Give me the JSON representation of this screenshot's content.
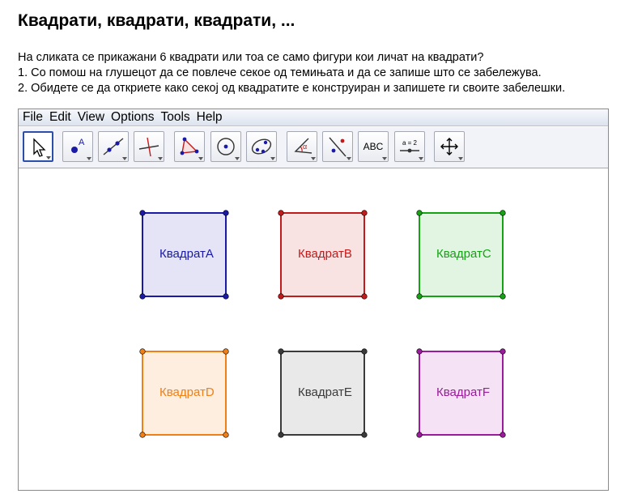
{
  "page": {
    "title": "Квадрати, квадрати, квадрати, ...",
    "instructions": [
      "На сликата се прикажани 6 квадрати или тоа се само фигури кои личат на квадрати?",
      "1. Со помош на глушецот да се повлече секое од темињата и да се запише што се забележува.",
      "2. Обидете се да откриете како секој од квадратите е конструиран и запишете ги своите забелешки."
    ]
  },
  "menu": {
    "items": [
      "File",
      "Edit",
      "View",
      "Options",
      "Tools",
      "Help"
    ]
  },
  "toolbar": {
    "tools": [
      {
        "icon": "move-arrow-icon",
        "selected": true
      },
      {
        "icon": "new-point-icon",
        "label": "A"
      },
      {
        "icon": "line-through-points-icon"
      },
      {
        "icon": "perpendicular-line-icon"
      },
      {
        "icon": "polygon-icon"
      },
      {
        "icon": "circle-center-point-icon"
      },
      {
        "icon": "conic-five-points-icon"
      },
      {
        "icon": "angle-icon",
        "label": "α"
      },
      {
        "icon": "reflect-about-line-icon"
      },
      {
        "icon": "insert-text-icon",
        "label": "ABC"
      },
      {
        "icon": "slider-icon",
        "label": "a = 2"
      },
      {
        "icon": "move-graphics-view-icon"
      }
    ]
  },
  "squares": [
    {
      "label": "КвадратA",
      "color": "#1a1aa6",
      "fill": "#e4e4f6"
    },
    {
      "label": "КвадратB",
      "color": "#c21b1b",
      "fill": "#f8e2e2"
    },
    {
      "label": "КвадратC",
      "color": "#13a313",
      "fill": "#e2f4e2"
    },
    {
      "label": "КвадратD",
      "color": "#f07f16",
      "fill": "#fdeedf"
    },
    {
      "label": "КвадратE",
      "color": "#3b3b3b",
      "fill": "#e9e9e9"
    },
    {
      "label": "КвадратF",
      "color": "#9c1a9c",
      "fill": "#f5e2f5"
    }
  ]
}
